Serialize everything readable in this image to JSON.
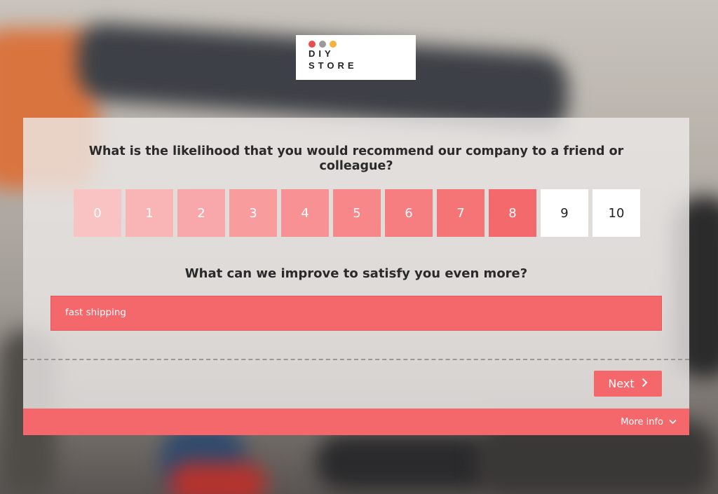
{
  "logo": {
    "line1": "DIY",
    "line2": "STORE",
    "dot_colors": [
      "#e94e4e",
      "#9a9a9a",
      "#f2b33d"
    ]
  },
  "survey": {
    "question1": "What is the likelihood that you would recommend our company to a friend or colleague?",
    "scale": [
      {
        "label": "0",
        "selected": true
      },
      {
        "label": "1",
        "selected": true
      },
      {
        "label": "2",
        "selected": true
      },
      {
        "label": "3",
        "selected": true
      },
      {
        "label": "4",
        "selected": true
      },
      {
        "label": "5",
        "selected": true
      },
      {
        "label": "6",
        "selected": true
      },
      {
        "label": "7",
        "selected": true
      },
      {
        "label": "8",
        "selected": true
      },
      {
        "label": "9",
        "selected": false
      },
      {
        "label": "10",
        "selected": false
      }
    ],
    "selected_score": 8,
    "question2": "What can we improve to satisfy you even more?",
    "answer_value": "fast shipping"
  },
  "actions": {
    "next_label": "Next",
    "next_icon": "chevron-right-icon"
  },
  "footer": {
    "more_info_label": "More info",
    "more_info_icon": "chevron-down-icon"
  },
  "colors": {
    "accent": "#f4676b",
    "unselected": "#ffffff"
  }
}
